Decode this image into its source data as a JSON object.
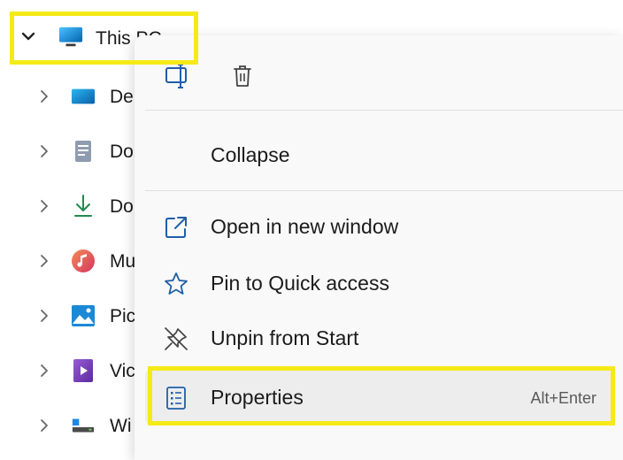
{
  "nav": {
    "root": {
      "label": "This PC",
      "icon": "monitor-icon"
    },
    "items": [
      {
        "label": "De",
        "icon": "desktop-folder-icon"
      },
      {
        "label": "Do",
        "icon": "documents-folder-icon"
      },
      {
        "label": "Do",
        "icon": "downloads-icon"
      },
      {
        "label": "Mu",
        "icon": "music-icon"
      },
      {
        "label": "Pic",
        "icon": "pictures-icon"
      },
      {
        "label": "Vic",
        "icon": "videos-icon"
      },
      {
        "label": "Wi",
        "icon": "drive-icon"
      }
    ]
  },
  "context_menu": {
    "quick_actions": [
      {
        "icon": "rename-icon"
      },
      {
        "icon": "delete-icon"
      }
    ],
    "items": [
      {
        "label": "Collapse"
      },
      {
        "label": "Open in new window",
        "icon": "open-new-window-icon"
      },
      {
        "label": "Pin to Quick access",
        "icon": "star-icon"
      },
      {
        "label": "Unpin from Start",
        "icon": "unpin-icon"
      },
      {
        "label": "Properties",
        "icon": "properties-icon",
        "shortcut": "Alt+Enter"
      }
    ]
  },
  "colors": {
    "highlight": "#f5ea17",
    "accent": "#0067c0",
    "menu_bg": "#f9f9f9"
  }
}
